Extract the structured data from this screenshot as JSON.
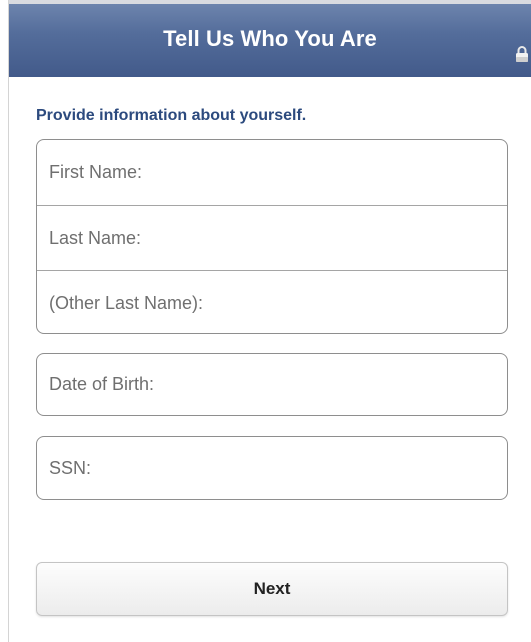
{
  "header": {
    "title": "Tell Us Who You Are",
    "lock_icon": "lock-icon"
  },
  "form": {
    "subtitle": "Provide information about yourself.",
    "fields": {
      "first_name": {
        "placeholder": "First Name:",
        "value": ""
      },
      "last_name": {
        "placeholder": "Last Name:",
        "value": ""
      },
      "other_last_name": {
        "placeholder": "(Other Last Name):",
        "value": ""
      },
      "date_of_birth": {
        "placeholder": "Date of Birth:",
        "value": ""
      },
      "ssn": {
        "placeholder": "SSN:",
        "value": ""
      }
    },
    "next_label": "Next"
  },
  "colors": {
    "header_bg": "#546d9b",
    "subtitle": "#2c4a7e"
  }
}
